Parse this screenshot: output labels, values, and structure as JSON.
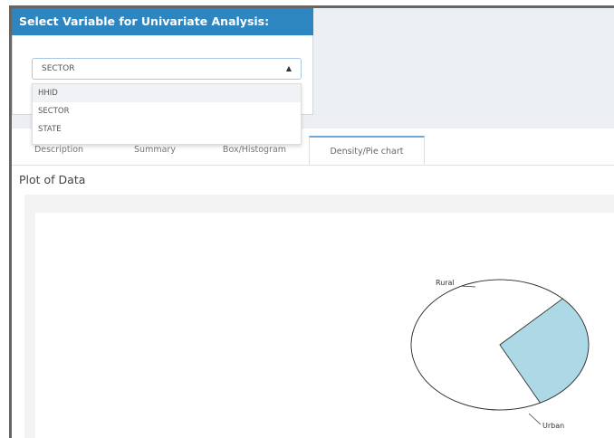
{
  "panel": {
    "title": "Select Variable for Univariate Analysis:",
    "select": {
      "value": "SECTOR",
      "caret": "▲"
    },
    "options": [
      "HHID",
      "SECTOR",
      "STATE"
    ]
  },
  "tabs": [
    {
      "label": "Description",
      "active": false
    },
    {
      "label": "Summary",
      "active": false
    },
    {
      "label": "Box/Histogram",
      "active": false
    },
    {
      "label": "Density/Pie chart",
      "active": true
    }
  ],
  "plot": {
    "title": "Plot of Data"
  },
  "chart_data": {
    "type": "pie",
    "categories": [
      "Rural",
      "Urban"
    ],
    "values": [
      70,
      30
    ],
    "colors": [
      "#ffffff",
      "#add8e6"
    ],
    "title": ""
  }
}
